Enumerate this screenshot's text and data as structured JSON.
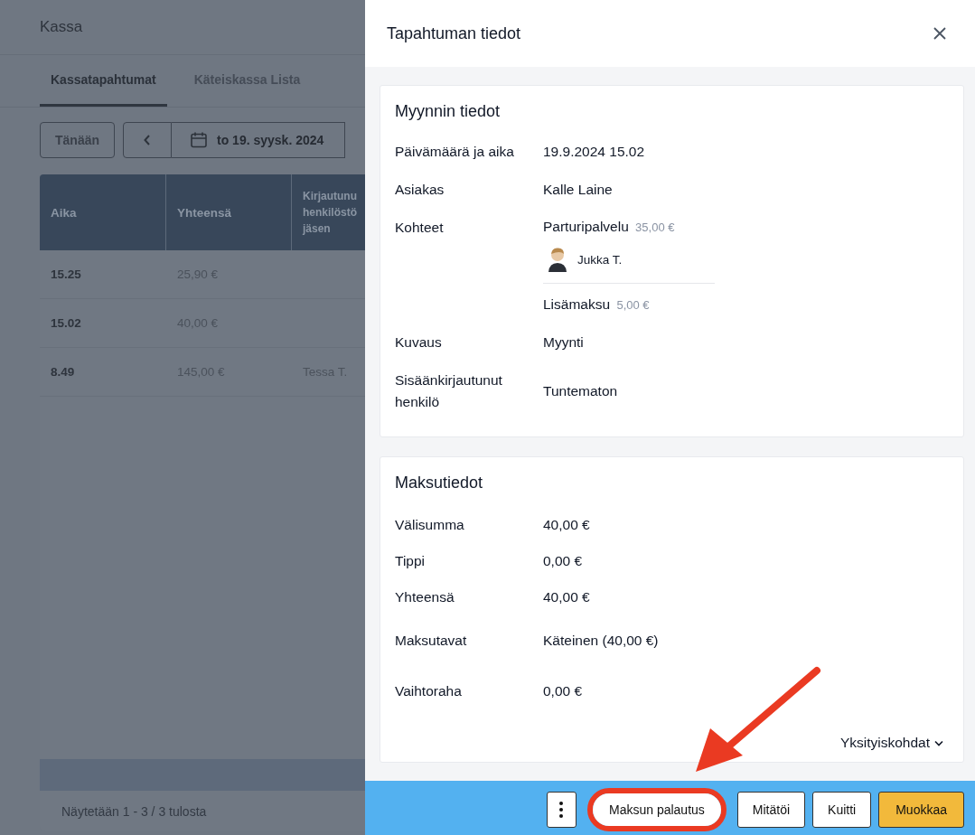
{
  "page": {
    "title": "Kassa",
    "tabs": [
      {
        "label": "Kassatapahtumat",
        "selected": true
      },
      {
        "label": "Käteiskassa Lista",
        "selected": false
      }
    ],
    "today_button": "Tänään",
    "date_picker": {
      "value": "to 19. syysk. 2024"
    },
    "table": {
      "columns": [
        "Aika",
        "Yhteensä",
        "Kirjautunu henkilöstö jäsen"
      ],
      "rows": [
        {
          "time": "15.25",
          "total": "25,90 €"
        },
        {
          "time": "15.02",
          "total": "40,00 €"
        },
        {
          "time": "8.49",
          "total": "145,00 €",
          "staff": "Tessa T."
        }
      ]
    },
    "pagination": "Näytetään 1 - 3 / 3 tulosta"
  },
  "drawer": {
    "title": "Tapahtuman tiedot",
    "sale": {
      "title": "Myynnin tiedot",
      "rows": [
        {
          "kind": "text",
          "label": "Päivämäärä ja aika",
          "value": "19.9.2024 15.02"
        },
        {
          "kind": "text",
          "label": "Asiakas",
          "value": "Kalle Laine"
        },
        {
          "kind": "items",
          "label": "Kohteet",
          "items": [
            {
              "name": "Parturipalvelu",
              "price": "35,00 €",
              "staff": "Jukka T."
            },
            {
              "name": "Lisämaksu",
              "price": "5,00 €"
            }
          ]
        },
        {
          "kind": "text",
          "label": "Kuvaus",
          "value": "Myynti"
        },
        {
          "kind": "text",
          "label": "Sisäänkirjautunut henkilö",
          "value": "Tuntematon"
        }
      ]
    },
    "payment": {
      "title": "Maksutiedot",
      "rows": [
        {
          "label": "Välisumma",
          "value": "40,00 €"
        },
        {
          "label": "Tippi",
          "value": "0,00 €"
        },
        {
          "label": "Yhteensä",
          "value": "40,00 €"
        },
        {
          "label": "Maksutavat",
          "value": "Käteinen (40,00 €)"
        },
        {
          "label": "Vaihtoraha",
          "value": "0,00 €"
        }
      ],
      "details_link": "Yksityiskohdat"
    },
    "actions": [
      {
        "kind": "more"
      },
      {
        "kind": "secondary",
        "label": "Maksun palautus",
        "highlighted": true
      },
      {
        "kind": "secondary",
        "label": "Mitätöi",
        "highlighted": false
      },
      {
        "kind": "secondary",
        "label": "Kuitti",
        "highlighted": false
      },
      {
        "kind": "primary",
        "label": "Muokkaa",
        "highlighted": false
      }
    ]
  }
}
